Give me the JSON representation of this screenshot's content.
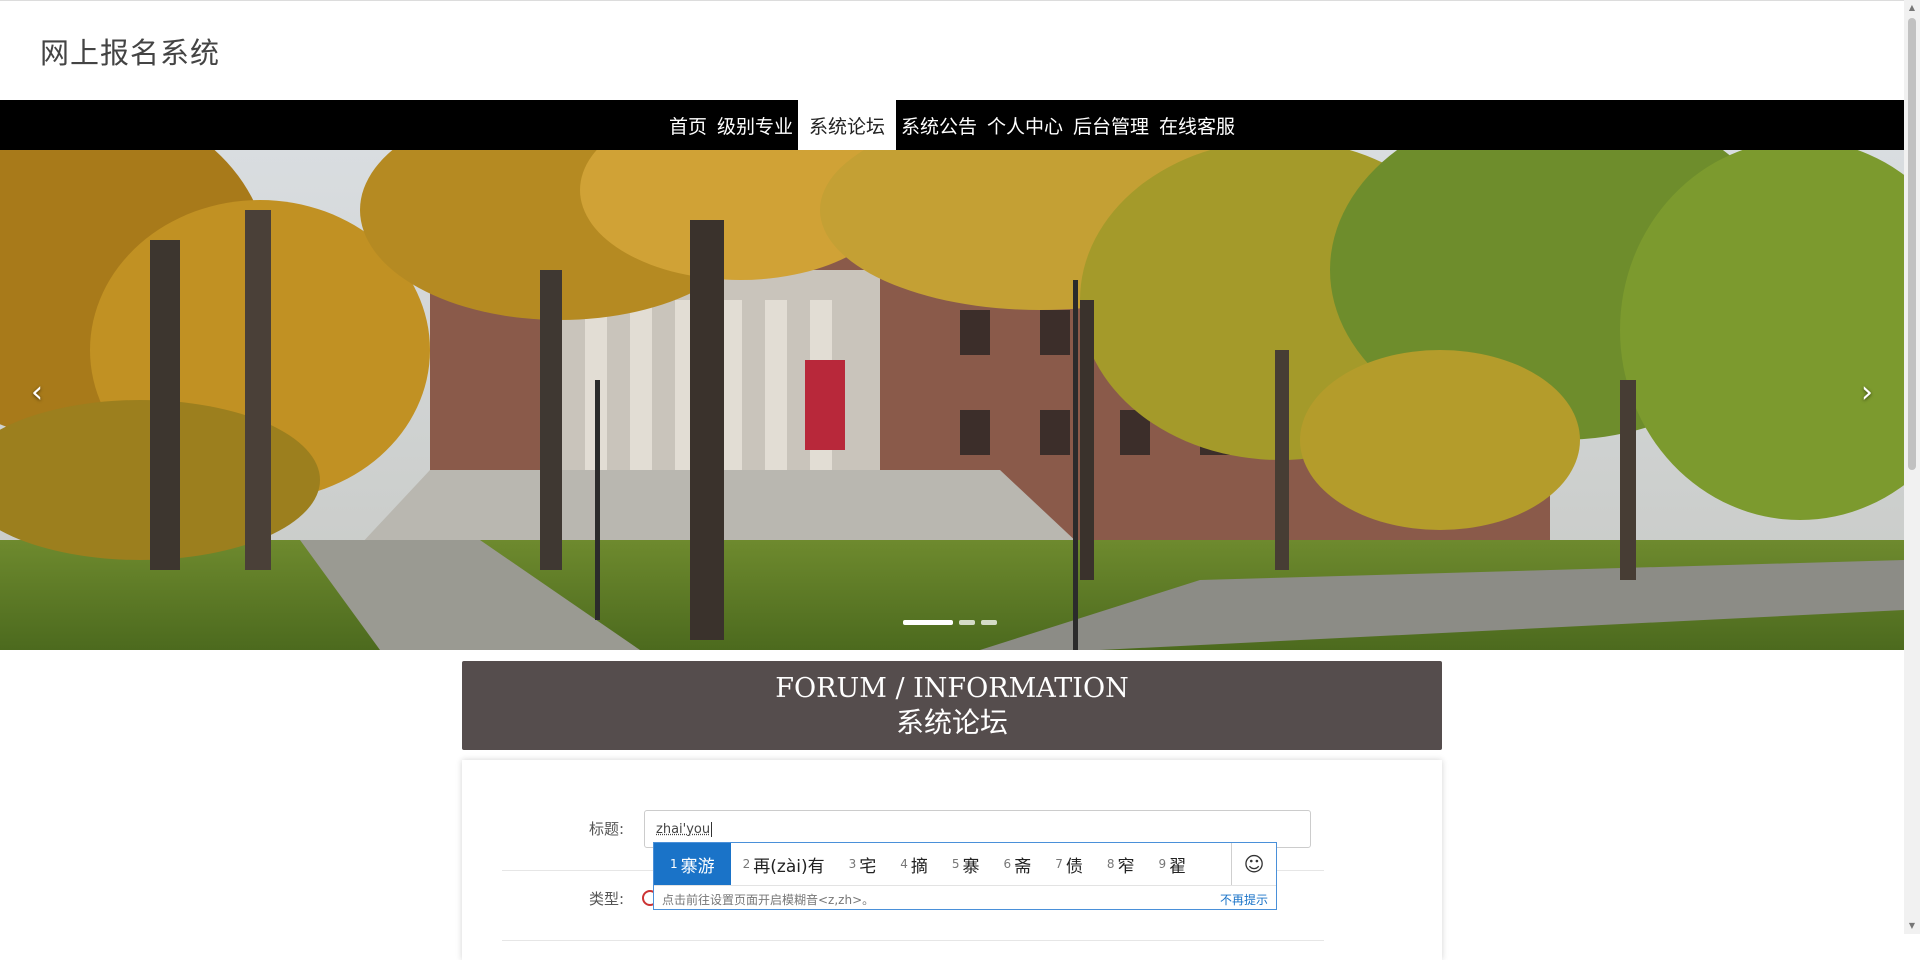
{
  "site": {
    "title": "网上报名系统"
  },
  "nav": {
    "items": [
      {
        "label": "首页"
      },
      {
        "label": "级别专业"
      },
      {
        "label": "系统论坛"
      },
      {
        "label": "系统公告"
      },
      {
        "label": "个人中心"
      },
      {
        "label": "后台管理"
      },
      {
        "label": "在线客服"
      }
    ],
    "active": "系统论坛"
  },
  "carousel": {
    "prev_icon": "‹",
    "next_icon": "›",
    "slide_count": 3,
    "active_index": 0
  },
  "section": {
    "title_en": "FORUM / INFORMATION",
    "title_cn": "系统论坛"
  },
  "form": {
    "title_label": "标题:",
    "title_value": "zhai'you",
    "type_label": "类型:"
  },
  "ime": {
    "candidates": [
      {
        "num": "1",
        "text": "寨游"
      },
      {
        "num": "2",
        "text": "再(zài)有"
      },
      {
        "num": "3",
        "text": "宅"
      },
      {
        "num": "4",
        "text": "摘"
      },
      {
        "num": "5",
        "text": "寨"
      },
      {
        "num": "6",
        "text": "斋"
      },
      {
        "num": "7",
        "text": "债"
      },
      {
        "num": "8",
        "text": "窄"
      },
      {
        "num": "9",
        "text": "翟"
      }
    ],
    "emoji_icon": "☺",
    "hint": "点击前往设置页面开启模糊音<z,zh>。",
    "dismiss": "不再提示"
  },
  "colors": {
    "nav_bg": "#000000",
    "section_header_bg": "#554d4d",
    "ime_selected": "#1a73c8"
  }
}
